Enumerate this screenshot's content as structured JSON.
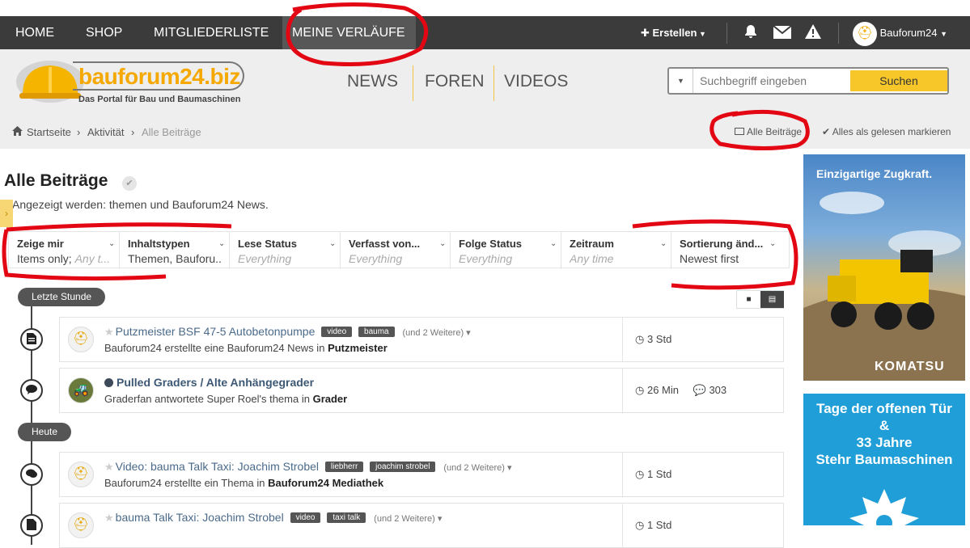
{
  "topnav": {
    "items": [
      "HOME",
      "SHOP",
      "MITGLIEDERLISTE",
      "MEINE VERLÄUFE"
    ],
    "create_label": "Erstellen",
    "user_label": "Bauforum24"
  },
  "header": {
    "logo_text": "bauforum24.biz",
    "logo_sub": "Das Portal für Bau und Baumaschinen",
    "nav": [
      "NEWS",
      "FOREN",
      "VIDEOS"
    ],
    "search": {
      "placeholder": "Suchbegriff eingeben",
      "button": "Suchen"
    }
  },
  "breadcrumb": {
    "items": [
      "Startseite",
      "Aktivität",
      "Alle Beiträge"
    ],
    "action_all": "Alle Beiträge",
    "action_mark_read": "Alles als gelesen markieren"
  },
  "page": {
    "title": "Alle Beiträge",
    "subtitle": "Angezeigt werden: themen und Bauforum24 News."
  },
  "filters": [
    {
      "label": "Zeige mir",
      "value": "Items only;",
      "muted": "Any t..."
    },
    {
      "label": "Inhaltstypen",
      "value": "Themen, Bauforu..",
      "muted": ""
    },
    {
      "label": "Lese Status",
      "value": "",
      "muted": "Everything"
    },
    {
      "label": "Verfasst von...",
      "value": "",
      "muted": "Everything"
    },
    {
      "label": "Folge Status",
      "value": "",
      "muted": "Everything"
    },
    {
      "label": "Zeitraum",
      "value": "",
      "muted": "Any time"
    },
    {
      "label": "Sortierung änd...",
      "value": "Newest first",
      "muted": ""
    }
  ],
  "periods": [
    "Letzte Stunde",
    "Heute"
  ],
  "stream": [
    {
      "title": "Putzmeister BSF 47-5 Autobetonpumpe",
      "tags": [
        "video",
        "bauma"
      ],
      "more": "(und 2 Weitere)",
      "sub_prefix": "Bauforum24 erstellte eine Bauforum24 News in",
      "sub_target": "Putzmeister",
      "time": "3 Std",
      "replies": ""
    },
    {
      "title": "Pulled Graders / Alte Anhängegrader",
      "tags": [],
      "more": "",
      "sub_prefix": "Graderfan antwortete Super Roel's thema in",
      "sub_target": "Grader",
      "time": "26 Min",
      "replies": "303"
    },
    {
      "title": "Video: bauma Talk Taxi: Joachim Strobel",
      "tags": [
        "liebherr",
        "joachim strobel"
      ],
      "more": "(und 2 Weitere)",
      "sub_prefix": "Bauforum24 erstellte ein Thema in",
      "sub_target": "Bauforum24 Mediathek",
      "time": "1 Std",
      "replies": ""
    },
    {
      "title": "bauma Talk Taxi: Joachim Strobel",
      "tags": [
        "video",
        "taxi talk"
      ],
      "more": "(und 2 Weitere)",
      "sub_prefix": "",
      "sub_target": "",
      "time": "1 Std",
      "replies": ""
    }
  ],
  "ads": {
    "ad1_title": "Einzigartige Zugkraft.",
    "ad1_brand": "KOMATSU",
    "ad2_lines": [
      "Tage der offenen Tür",
      "&",
      "33 Jahre",
      "Stehr Baumaschinen"
    ]
  },
  "colors": {
    "navbar": "#3b3b3b",
    "accent": "#f7c72a",
    "annotation": "#e30613",
    "link": "#4a6a8a"
  }
}
